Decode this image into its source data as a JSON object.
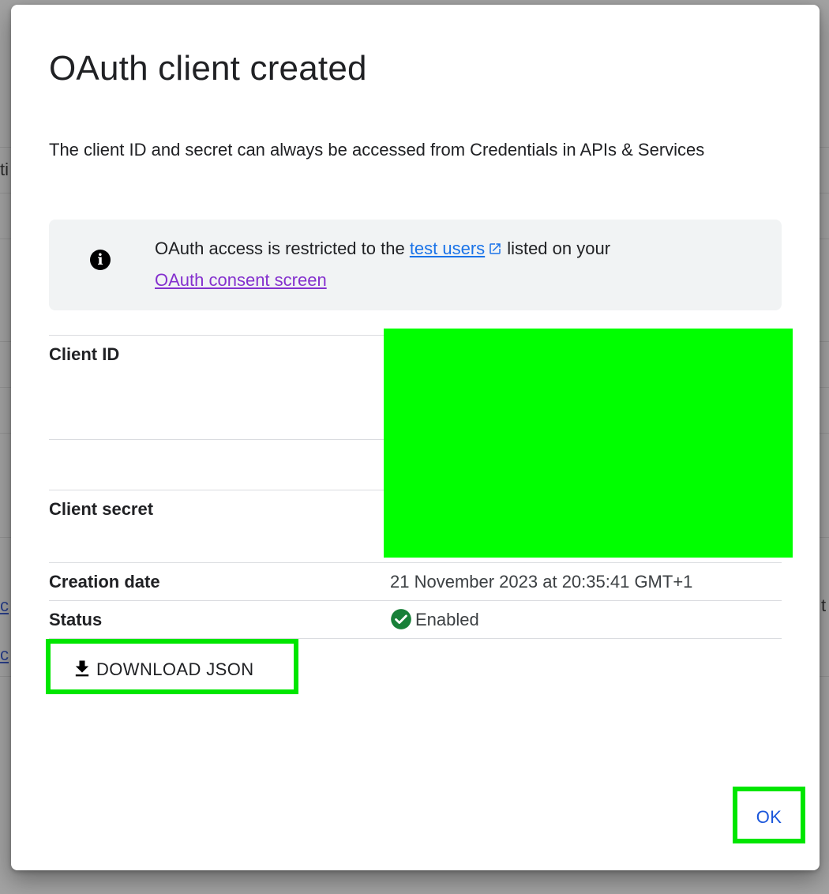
{
  "dialog": {
    "title": "OAuth client created",
    "description": "The client ID and secret can always be accessed from Credentials in APIs & Services",
    "info": {
      "icon": "info-icon",
      "text_before": "OAuth access is restricted to the ",
      "test_users_link": "test users",
      "text_after": "listed on your",
      "consent_link": "OAuth consent screen"
    },
    "fields": {
      "client_id_label": "Client ID",
      "client_secret_label": "Client secret",
      "creation_date_label": "Creation date",
      "creation_date_value": "21 November 2023 at 20:35:41 GMT+1",
      "status_label": "Status",
      "status_value": "Enabled"
    },
    "download_button": "DOWNLOAD JSON",
    "ok_button": "OK"
  },
  "colors": {
    "link": "#1a73e8",
    "visited_link": "#8430ce",
    "status_ok": "#188038",
    "highlight": "#00ff00"
  },
  "background_fragments": {
    "left_top": "ti",
    "left_link_1": "c",
    "left_link_2": "c",
    "right_mid": "t"
  }
}
